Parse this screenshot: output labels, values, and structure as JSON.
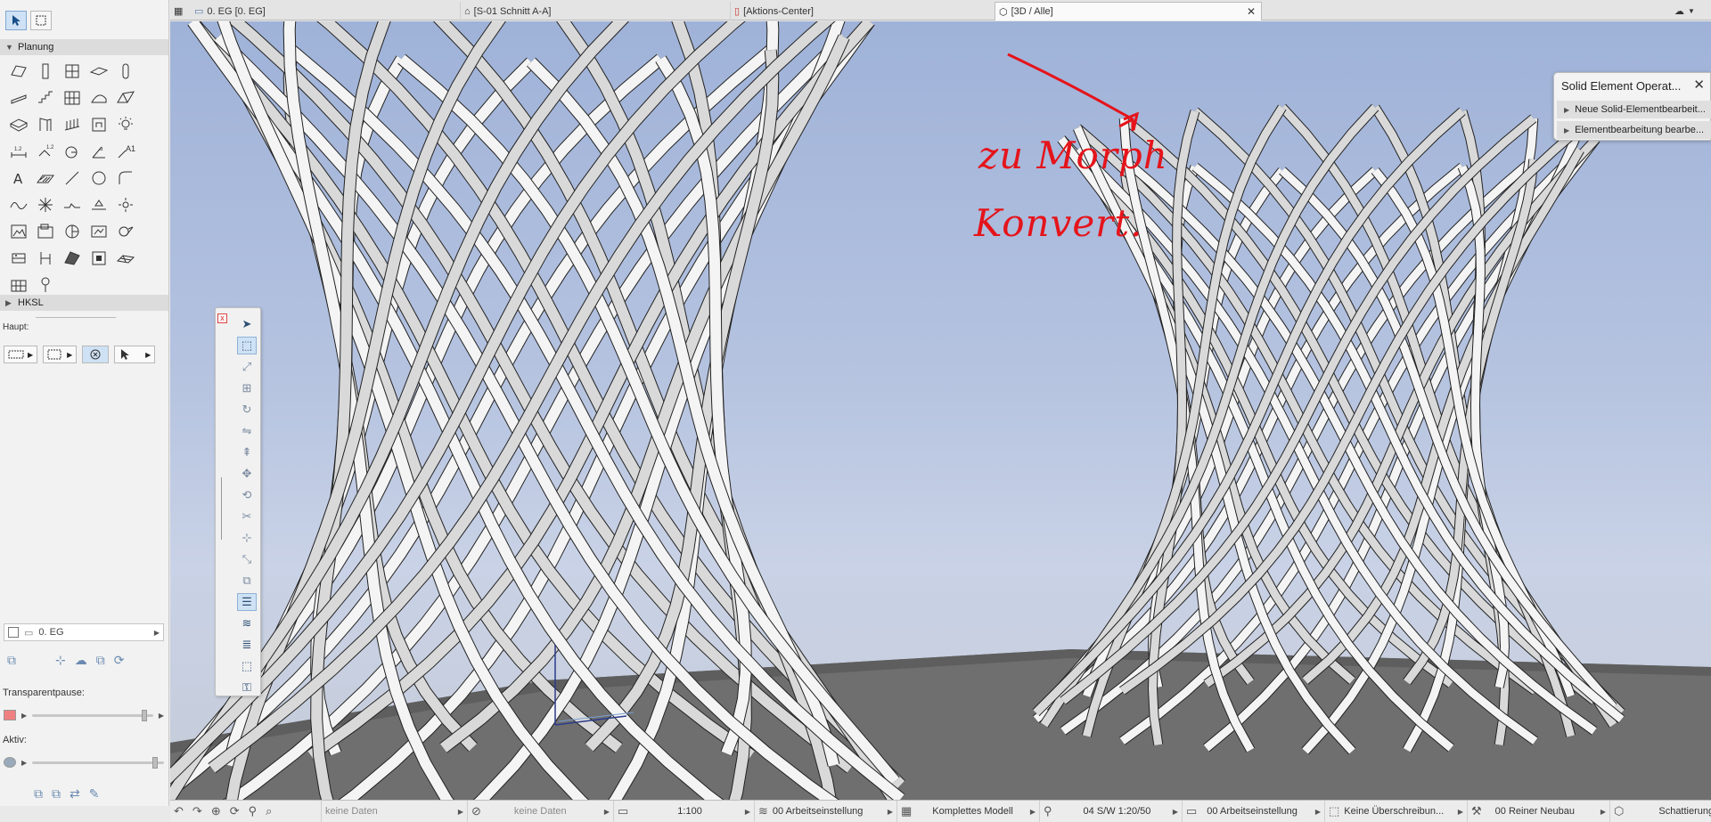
{
  "tabs": [
    {
      "label": "0. EG [0. EG]",
      "icon": "floorplan-icon",
      "active": false
    },
    {
      "label": "[S-01 Schnitt A-A]",
      "icon": "section-icon",
      "active": false
    },
    {
      "label": "[Aktions-Center]",
      "icon": "action-center-icon",
      "active": false
    },
    {
      "label": "[3D / Alle]",
      "icon": "3d-icon",
      "active": true
    }
  ],
  "toolbox": {
    "section_planung": "Planung",
    "section_hksl": "HKSL",
    "haupt_label": "Haupt:",
    "story_value": "0. EG",
    "transparent_label": "Transparentpause:",
    "aktiv_label": "Aktiv:",
    "transparent_level": 0.95,
    "aktiv_level": 0.95
  },
  "solid_panel": {
    "title": "Solid Element Operat...",
    "rows": [
      "Neue Solid-Elementbearbeit...",
      "Elementbearbeitung bearbe..."
    ]
  },
  "annotation": {
    "line1": "zu Morph",
    "line2": "Konvert.",
    "color": "#e5141b"
  },
  "statusbar": {
    "nav_undo": "undo-icon",
    "data1": "keine Daten",
    "data2": "keine Daten",
    "scale": "1:100",
    "layer_combo": "00 Arbeitseinstellung",
    "model_view": "Komplettes Modell",
    "pen_set": "04 S/W 1:20/50",
    "model_view_option": "00 Arbeitseinstellung",
    "override": "Keine Überschreibun...",
    "renovation": "00 Reiner Neubau",
    "render_mode": "Schattierung"
  },
  "colors": {
    "sky_top": "#9fb2d8",
    "ground": "#6f6f6f",
    "selected_tool": "#cfe2f5",
    "annotation_red": "#e5141b"
  }
}
